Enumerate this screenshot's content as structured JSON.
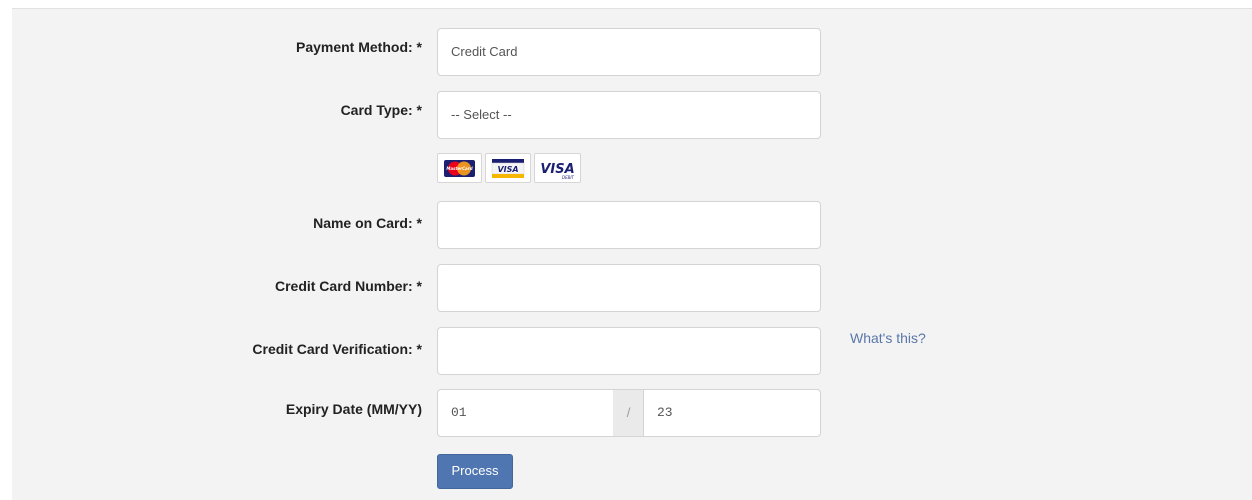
{
  "form": {
    "payment_method": {
      "label": "Payment Method: *",
      "value": "Credit Card"
    },
    "card_type": {
      "label": "Card Type: *",
      "value": "-- Select --"
    },
    "card_logos": [
      "mastercard-icon",
      "visa-electron-icon",
      "visa-debit-icon"
    ],
    "card_logo_text": {
      "mastercard": "MasterCard",
      "visa_electron": "VISA",
      "visa": "VISA",
      "visa_debit": "DEBIT"
    },
    "name_on_card": {
      "label": "Name on Card: *",
      "value": ""
    },
    "card_number": {
      "label": "Credit Card Number: *",
      "value": ""
    },
    "card_verification": {
      "label": "Credit Card Verification: *",
      "value": "",
      "help": "What's this?"
    },
    "expiry": {
      "label": "Expiry Date (MM/YY)",
      "month": "01",
      "separator": "/",
      "year": "23"
    },
    "submit_label": "Process"
  },
  "colors": {
    "panel_background": "#f3f3f3",
    "button_primary": "#4f76b0",
    "link": "#5a77a9",
    "mastercard_red": "#eb001b",
    "mastercard_orange": "#f79e1b",
    "visa_blue": "#1a1f71",
    "visa_gold": "#f7b600"
  }
}
